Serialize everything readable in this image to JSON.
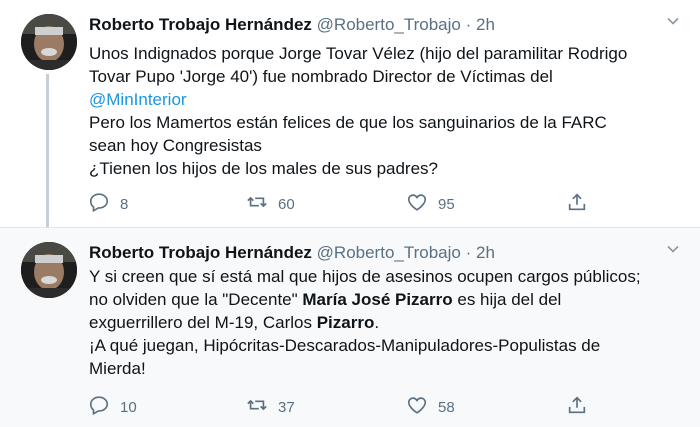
{
  "tweets": [
    {
      "author": "Roberto Trobajo Hernández",
      "handle": "@Roberto_Trobajo",
      "separator": "·",
      "time": "2h",
      "lines": [
        "Unos Indignados porque Jorge Tovar Vélez (hijo del paramilitar Rodrigo",
        "Tovar Pupo 'Jorge 40') fue nombrado Director de Víctimas del",
        "@MinInterior",
        "Pero los Mamertos están felices de que los sanguinarios de la FARC",
        "sean hoy Congresistas",
        "¿Tienen los hijos de los males de sus padres?"
      ],
      "replies": "8",
      "retweets": "60",
      "likes": "95"
    },
    {
      "author": "Roberto Trobajo Hernández",
      "handle": "@Roberto_Trobajo",
      "separator": "·",
      "time": "2h",
      "line1": "Y si creen que sí está mal que hijos de asesinos ocupen cargos públicos;",
      "line2_a": "no olviden que la \"Decente\" ",
      "line2_bold": "María José Pizarro",
      "line2_b": " es hija del del",
      "line3_a": "exguerrillero del M-19, Carlos ",
      "line3_bold": "Pizarro",
      "line3_b": ".",
      "line4": "¡A qué juegan, Hipócritas-Descarados-Manipuladores-Populistas de",
      "line5": "Mierda!",
      "replies": "10",
      "retweets": "37",
      "likes": "58"
    }
  ],
  "icons": {
    "more": "chevron-down-icon",
    "reply": "reply-icon",
    "retweet": "retweet-icon",
    "like": "heart-icon",
    "share": "share-icon"
  },
  "colors": {
    "mention": "#1b95e0",
    "secondary_text": "#5b7083",
    "thread_line": "#c4cfd6",
    "second_tweet_bg": "#f7f9fa"
  }
}
